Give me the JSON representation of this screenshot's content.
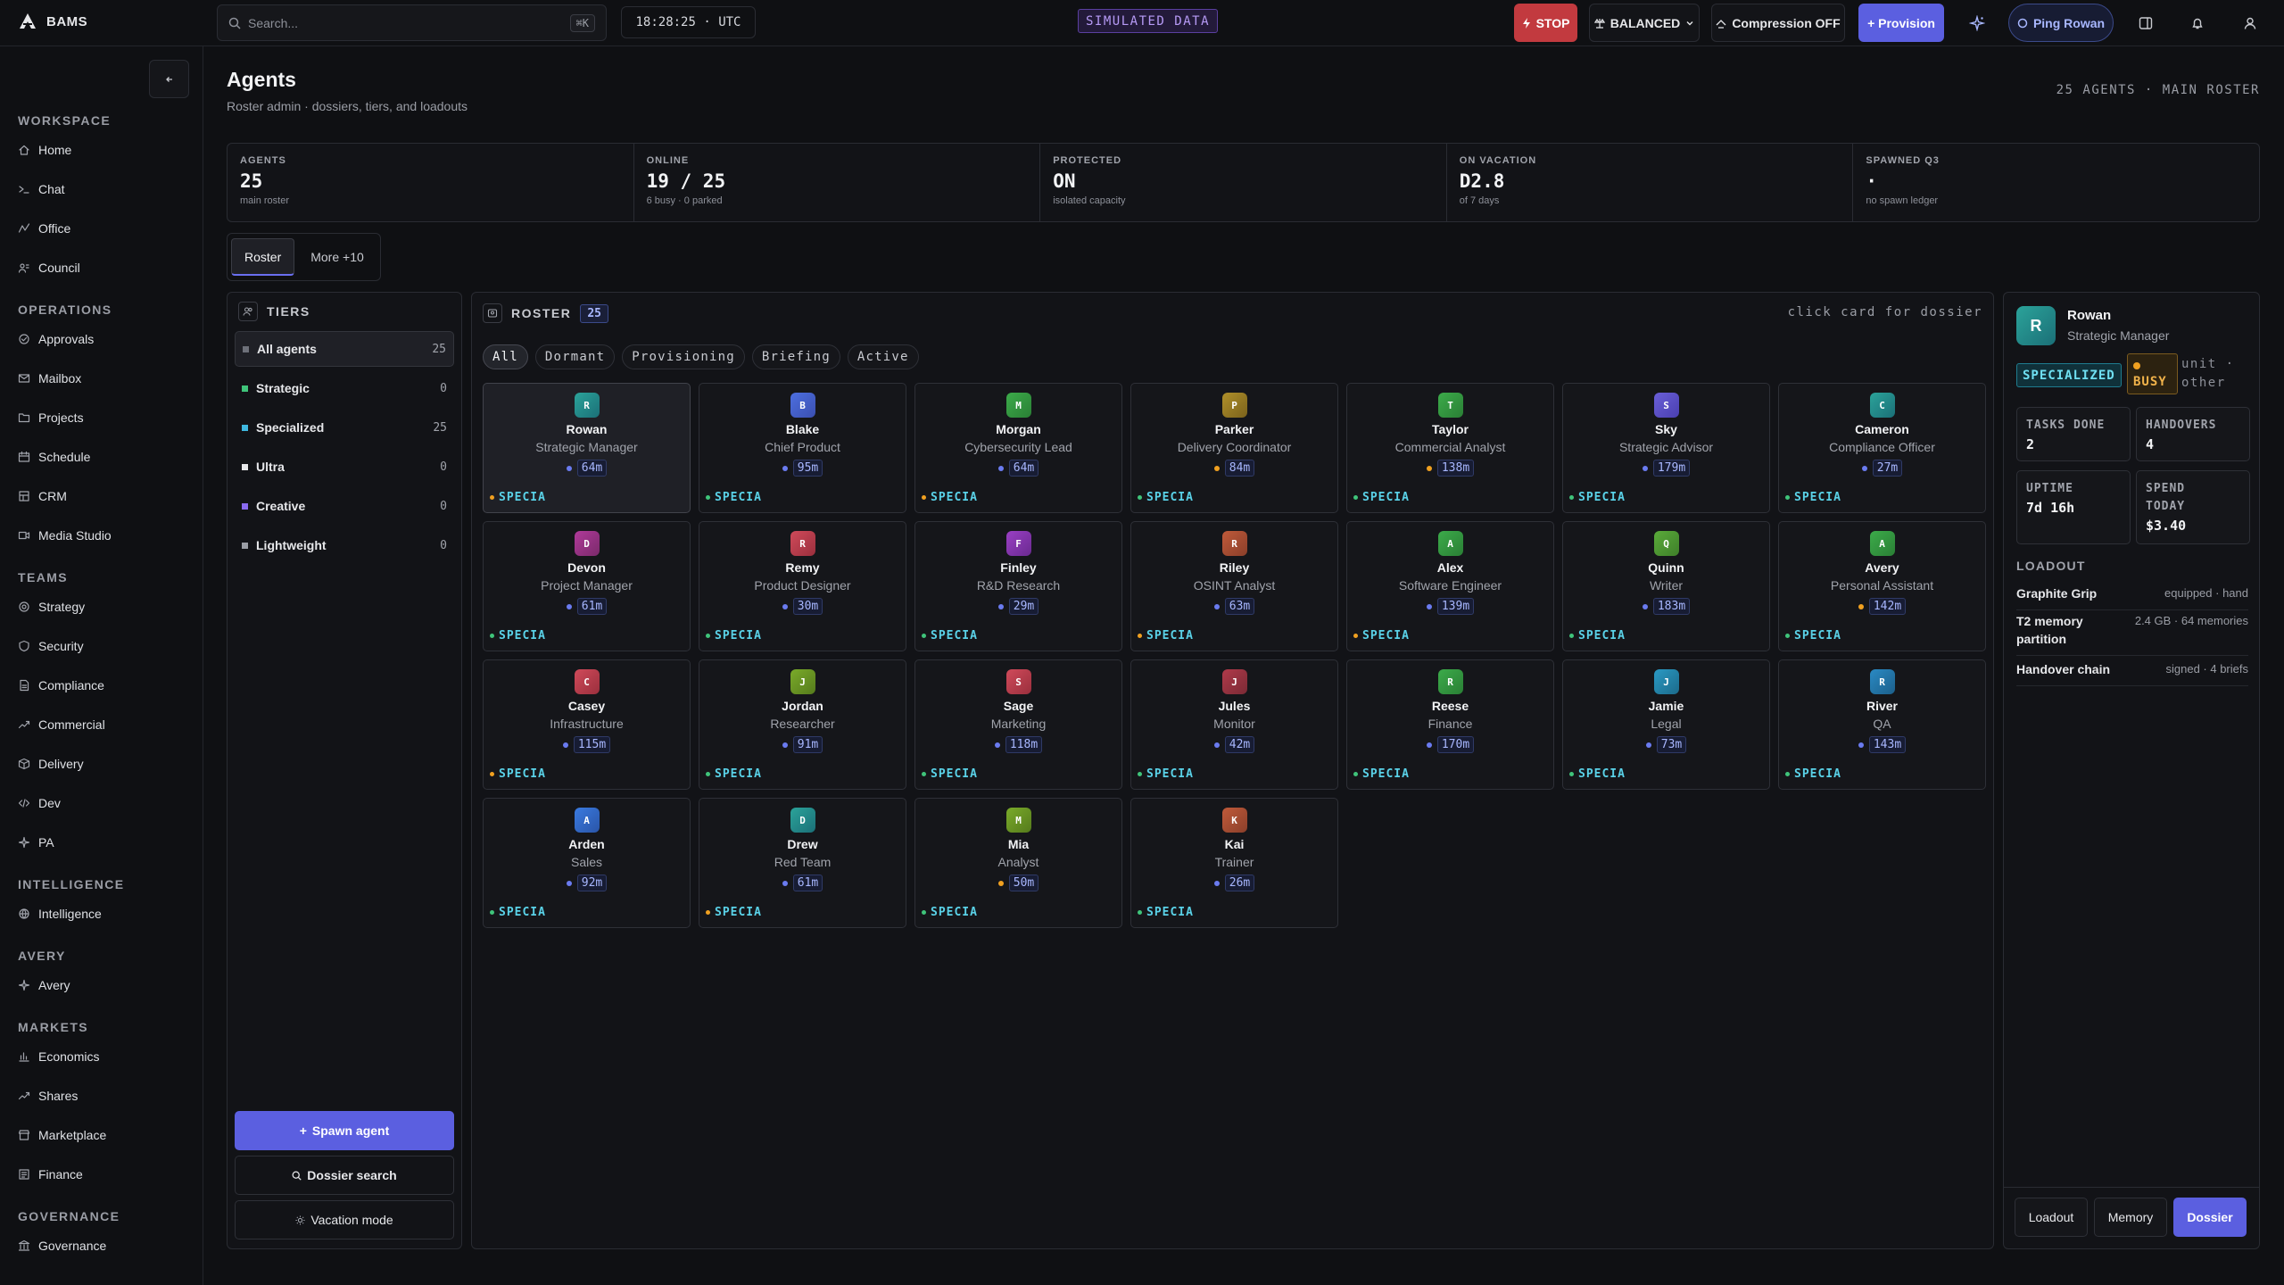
{
  "app": {
    "name": "BAMS"
  },
  "topbar": {
    "search_placeholder": "Search...",
    "search_shortcut": "⌘K",
    "clock": "18:28:25 · UTC",
    "simulated": "SIMULATED DATA",
    "stop_label": "STOP",
    "balance_label": "BALANCED",
    "compression_label": "Compression OFF",
    "provision_label": "+ Provision",
    "ping_label": "Ping Rowan"
  },
  "sidebar": {
    "sections": [
      {
        "title": "WORKSPACE",
        "items": [
          "Home",
          "Chat",
          "Office",
          "Council"
        ]
      },
      {
        "title": "OPERATIONS",
        "items": [
          "Approvals",
          "Mailbox",
          "Projects",
          "Schedule",
          "CRM",
          "Media Studio"
        ]
      },
      {
        "title": "TEAMS",
        "items": [
          "Strategy",
          "Security",
          "Compliance",
          "Commercial",
          "Delivery",
          "Dev",
          "PA"
        ]
      },
      {
        "title": "INTELLIGENCE",
        "items": [
          "Intelligence"
        ]
      },
      {
        "title": "AVERY",
        "items": [
          "Avery"
        ]
      },
      {
        "title": "MARKETS",
        "items": [
          "Economics",
          "Shares",
          "Marketplace",
          "Finance"
        ]
      },
      {
        "title": "GOVERNANCE",
        "items": [
          "Governance"
        ]
      }
    ]
  },
  "page": {
    "title": "Agents",
    "subtitle": "Roster admin · dossiers, tiers, and loadouts",
    "meta": "25 AGENTS · MAIN ROSTER"
  },
  "stats": [
    {
      "label": "AGENTS",
      "value": "25",
      "note": "main roster"
    },
    {
      "label": "ONLINE",
      "value": "19 / 25",
      "note": "6 busy · 0 parked"
    },
    {
      "label": "PROTECTED",
      "value": "ON",
      "note": "isolated capacity"
    },
    {
      "label": "ON VACATION",
      "value": "D2.8",
      "note": "of 7 days"
    },
    {
      "label": "SPAWNED Q3",
      "value": "·",
      "note": "no spawn ledger"
    }
  ],
  "tabs": [
    "Roster",
    "More +10"
  ],
  "tiers": {
    "title": "TIERS",
    "rows": [
      {
        "name": "All agents",
        "count": "25",
        "color": "#6d7079"
      },
      {
        "name": "Strategic",
        "count": "0",
        "color": "#3fc47a"
      },
      {
        "name": "Specialized",
        "count": "25",
        "color": "#3fb8e0"
      },
      {
        "name": "Ultra",
        "count": "0",
        "color": "#e6e7ea"
      },
      {
        "name": "Creative",
        "count": "0",
        "color": "#8a6af0"
      },
      {
        "name": "Lightweight",
        "count": "0",
        "color": "#9a9da5"
      }
    ],
    "spawn_label": "Spawn agent",
    "dossier_search_label": "Dossier search",
    "vacation_label": "Vacation mode"
  },
  "roster": {
    "title": "ROSTER",
    "count": "25",
    "hint": "click card for dossier",
    "filters": [
      "All",
      "Dormant",
      "Provisioning",
      "Briefing",
      "Active"
    ],
    "agents": [
      {
        "initial": "R",
        "name": "Rowan",
        "role": "Strategic Manager",
        "time": "64m",
        "status": "#6a7bf0",
        "tier": "SPECIA",
        "tier_dot": "#f0a020",
        "grad": [
          "#2ba39a",
          "#1b6f77"
        ]
      },
      {
        "initial": "B",
        "name": "Blake",
        "role": "Chief Product",
        "time": "95m",
        "status": "#6a7bf0",
        "tier": "SPECIA",
        "tier_dot": "#3fc47a",
        "grad": [
          "#4d6fe0",
          "#3a4fb0"
        ]
      },
      {
        "initial": "M",
        "name": "Morgan",
        "role": "Cybersecurity Lead",
        "time": "64m",
        "status": "#6a7bf0",
        "tier": "SPECIA",
        "tier_dot": "#f0a020",
        "grad": [
          "#3cab4a",
          "#2a7f35"
        ]
      },
      {
        "initial": "P",
        "name": "Parker",
        "role": "Delivery Coordinator",
        "time": "84m",
        "status": "#f0a020",
        "tier": "SPECIA",
        "tier_dot": "#3fc47a",
        "grad": [
          "#b0902a",
          "#7a621c"
        ]
      },
      {
        "initial": "T",
        "name": "Taylor",
        "role": "Commercial Analyst",
        "time": "138m",
        "status": "#f0a020",
        "tier": "SPECIA",
        "tier_dot": "#3fc47a",
        "grad": [
          "#3cab4a",
          "#2a7f35"
        ]
      },
      {
        "initial": "S",
        "name": "Sky",
        "role": "Strategic Advisor",
        "time": "179m",
        "status": "#6a7bf0",
        "tier": "SPECIA",
        "tier_dot": "#3fc47a",
        "grad": [
          "#6a5fd8",
          "#4a3fb0"
        ]
      },
      {
        "initial": "C",
        "name": "Cameron",
        "role": "Compliance Officer",
        "time": "27m",
        "status": "#6a7bf0",
        "tier": "SPECIA",
        "tier_dot": "#3fc47a",
        "grad": [
          "#2ba39a",
          "#1b6f77"
        ]
      },
      {
        "initial": "D",
        "name": "Devon",
        "role": "Project Manager",
        "time": "61m",
        "status": "#6a7bf0",
        "tier": "SPECIA",
        "tier_dot": "#3fc47a",
        "grad": [
          "#b03a9a",
          "#7a2a6a"
        ]
      },
      {
        "initial": "R",
        "name": "Remy",
        "role": "Product Designer",
        "time": "30m",
        "status": "#6a7bf0",
        "tier": "SPECIA",
        "tier_dot": "#3fc47a",
        "grad": [
          "#d04a5a",
          "#9a2f3d"
        ]
      },
      {
        "initial": "F",
        "name": "Finley",
        "role": "R&D Research",
        "time": "29m",
        "status": "#6a7bf0",
        "tier": "SPECIA",
        "tier_dot": "#3fc47a",
        "grad": [
          "#9a3fc4",
          "#6a2a90"
        ]
      },
      {
        "initial": "R",
        "name": "Riley",
        "role": "OSINT Analyst",
        "time": "63m",
        "status": "#6a7bf0",
        "tier": "SPECIA",
        "tier_dot": "#f0a020",
        "grad": [
          "#c05a3a",
          "#8a3f2a"
        ]
      },
      {
        "initial": "A",
        "name": "Alex",
        "role": "Software Engineer",
        "time": "139m",
        "status": "#6a7bf0",
        "tier": "SPECIA",
        "tier_dot": "#f0a020",
        "grad": [
          "#3cab4a",
          "#2a7f35"
        ]
      },
      {
        "initial": "Q",
        "name": "Quinn",
        "role": "Writer",
        "time": "183m",
        "status": "#6a7bf0",
        "tier": "SPECIA",
        "tier_dot": "#3fc47a",
        "grad": [
          "#5aab3a",
          "#3f7f2a"
        ]
      },
      {
        "initial": "A",
        "name": "Avery",
        "role": "Personal Assistant",
        "time": "142m",
        "status": "#f0a020",
        "tier": "SPECIA",
        "tier_dot": "#3fc47a",
        "grad": [
          "#3cab4a",
          "#2a7f35"
        ]
      },
      {
        "initial": "C",
        "name": "Casey",
        "role": "Infrastructure",
        "time": "115m",
        "status": "#6a7bf0",
        "tier": "SPECIA",
        "tier_dot": "#f0a020",
        "grad": [
          "#d04a5a",
          "#9a2f3d"
        ]
      },
      {
        "initial": "J",
        "name": "Jordan",
        "role": "Researcher",
        "time": "91m",
        "status": "#6a7bf0",
        "tier": "SPECIA",
        "tier_dot": "#3fc47a",
        "grad": [
          "#7aab2a",
          "#557a1c"
        ]
      },
      {
        "initial": "S",
        "name": "Sage",
        "role": "Marketing",
        "time": "118m",
        "status": "#6a7bf0",
        "tier": "SPECIA",
        "tier_dot": "#3fc47a",
        "grad": [
          "#d04a5a",
          "#9a2f3d"
        ]
      },
      {
        "initial": "J",
        "name": "Jules",
        "role": "Monitor",
        "time": "42m",
        "status": "#6a7bf0",
        "tier": "SPECIA",
        "tier_dot": "#3fc47a",
        "grad": [
          "#b03a4a",
          "#7a2a35"
        ]
      },
      {
        "initial": "R",
        "name": "Reese",
        "role": "Finance",
        "time": "170m",
        "status": "#6a7bf0",
        "tier": "SPECIA",
        "tier_dot": "#3fc47a",
        "grad": [
          "#3cab4a",
          "#2a7f35"
        ]
      },
      {
        "initial": "J",
        "name": "Jamie",
        "role": "Legal",
        "time": "73m",
        "status": "#6a7bf0",
        "tier": "SPECIA",
        "tier_dot": "#3fc47a",
        "grad": [
          "#2a9ac4",
          "#1c6a8a"
        ]
      },
      {
        "initial": "R",
        "name": "River",
        "role": "QA",
        "time": "143m",
        "status": "#6a7bf0",
        "tier": "SPECIA",
        "tier_dot": "#3fc47a",
        "grad": [
          "#2a8ac4",
          "#1c5f8a"
        ]
      },
      {
        "initial": "A",
        "name": "Arden",
        "role": "Sales",
        "time": "92m",
        "status": "#6a7bf0",
        "tier": "SPECIA",
        "tier_dot": "#3fc47a",
        "grad": [
          "#3a7ae0",
          "#2a55a8"
        ]
      },
      {
        "initial": "D",
        "name": "Drew",
        "role": "Red Team",
        "time": "61m",
        "status": "#6a7bf0",
        "tier": "SPECIA",
        "tier_dot": "#f0a020",
        "grad": [
          "#2ba39a",
          "#1b6f77"
        ]
      },
      {
        "initial": "M",
        "name": "Mia",
        "role": "Analyst",
        "time": "50m",
        "status": "#f0a020",
        "tier": "SPECIA",
        "tier_dot": "#3fc47a",
        "grad": [
          "#7aab2a",
          "#557a1c"
        ]
      },
      {
        "initial": "K",
        "name": "Kai",
        "role": "Trainer",
        "time": "26m",
        "status": "#6a7bf0",
        "tier": "SPECIA",
        "tier_dot": "#3fc47a",
        "grad": [
          "#c05a3a",
          "#8a3f2a"
        ]
      }
    ]
  },
  "dossier": {
    "initial": "R",
    "name": "Rowan",
    "role": "Strategic Manager",
    "tier_badge": "SPECIALIZED",
    "status_badge": "BUSY",
    "unit": "unit · other",
    "stats": [
      {
        "label": "TASKS DONE",
        "value": "2"
      },
      {
        "label": "HANDOVERS",
        "value": "4"
      },
      {
        "label": "UPTIME",
        "value": "7d 16h"
      },
      {
        "label": "SPEND TODAY",
        "value": "$3.40"
      }
    ],
    "loadout_title": "LOADOUT",
    "loadout": [
      {
        "name": "Graphite Grip",
        "value": "equipped · hand"
      },
      {
        "name": "T2 memory partition",
        "value": "2.4 GB · 64 memories"
      },
      {
        "name": "Handover chain",
        "value": "signed · 4 briefs"
      }
    ],
    "buttons": [
      "Loadout",
      "Memory",
      "Dossier"
    ]
  }
}
